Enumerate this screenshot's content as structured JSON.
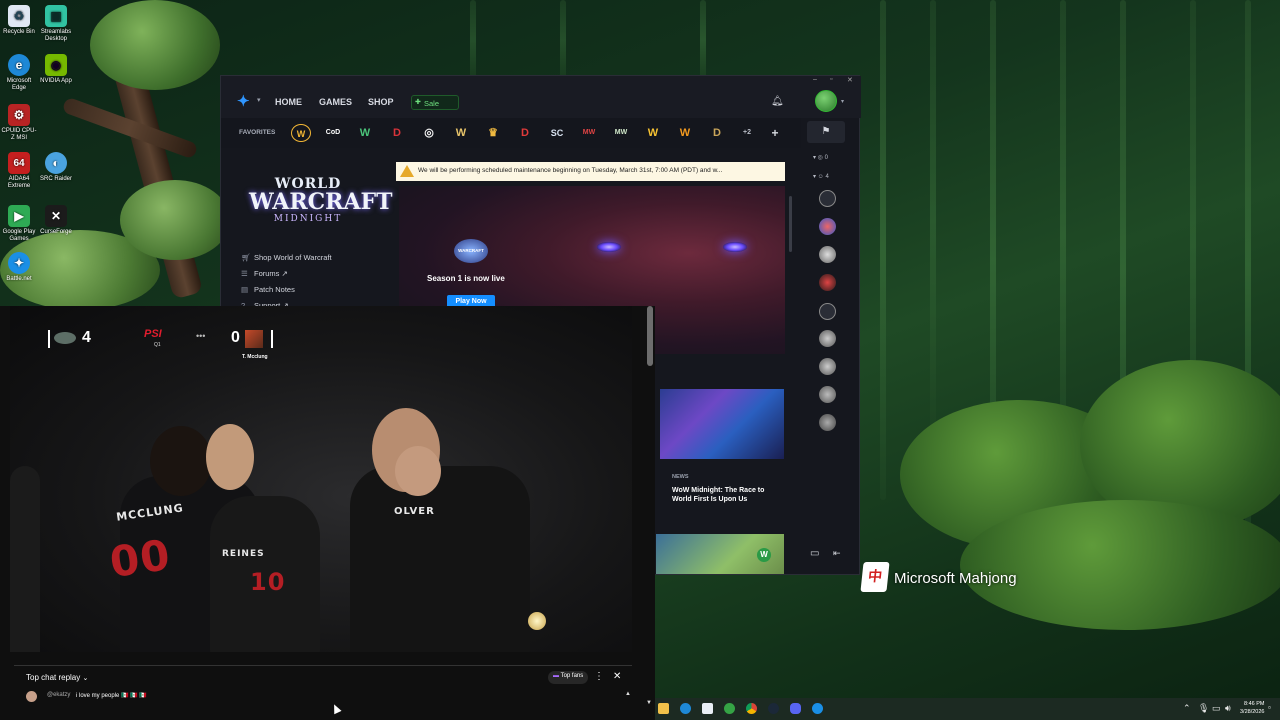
{
  "desktop": {
    "icons": [
      {
        "label": "Recycle Bin",
        "icon": "recycle-bin-icon",
        "color": "#dfe7f3",
        "glyph": "♻"
      },
      {
        "label": "Streamlabs Desktop",
        "icon": "streamlabs-icon",
        "color": "#31c3a2",
        "glyph": "▣"
      },
      {
        "label": "Microsoft Edge",
        "icon": "edge-icon",
        "color": "#1e88d6",
        "glyph": "e"
      },
      {
        "label": "NVIDIA App",
        "icon": "nvidia-icon",
        "color": "#76b900",
        "glyph": "◉"
      },
      {
        "label": "CPUID CPU-Z MSI",
        "icon": "cpuz-icon",
        "color": "#b82424",
        "glyph": "⚙"
      },
      {
        "label": "AIDA64 Extreme",
        "icon": "aida64-icon",
        "color": "#c41f1f",
        "glyph": "64"
      },
      {
        "label": "SRC Raider",
        "icon": "src-raider-icon",
        "color": "#4aa3df",
        "glyph": "◐"
      },
      {
        "label": "Google Play Games",
        "icon": "google-play-games-icon",
        "color": "#2eaa54",
        "glyph": "▶"
      },
      {
        "label": "CurseForge",
        "icon": "curseforge-icon",
        "color": "#1b1b1b",
        "glyph": "✕"
      },
      {
        "label": "Battle.net",
        "icon": "battlenet-icon",
        "color": "#1a8fe6",
        "glyph": "✦"
      }
    ],
    "mahjong_label": "Microsoft Mahjong",
    "mahjong_tile": "中"
  },
  "bnet": {
    "nav": {
      "home": "HOME",
      "games": "GAMES",
      "shop": "SHOP",
      "sale": "Sale"
    },
    "favorites_label": "FAVORITES",
    "favorites": [
      {
        "glyph": "W",
        "color": "#f2b635",
        "icon": "wow-favorite-icon"
      },
      {
        "glyph": "CoD",
        "color": "#ffffff",
        "icon": "call-of-duty-favorite-icon"
      },
      {
        "glyph": "W",
        "color": "#4bc47a",
        "icon": "wow-classic-favorite-icon"
      },
      {
        "glyph": "D",
        "color": "#d8333a",
        "icon": "diablo-favorite-icon"
      },
      {
        "glyph": "◎",
        "color": "#f2f2f2",
        "icon": "overwatch-favorite-icon"
      },
      {
        "glyph": "W",
        "color": "#e8c46a",
        "icon": "warcraft-favorite-icon"
      },
      {
        "glyph": "♛",
        "color": "#f0b940",
        "icon": "hearthstone-favorite-icon"
      },
      {
        "glyph": "D",
        "color": "#e03a3a",
        "icon": "diablo-immortal-favorite-icon"
      },
      {
        "glyph": "SC",
        "color": "#d8e2f0",
        "icon": "starcraft-favorite-icon"
      },
      {
        "glyph": "MW",
        "color": "#e04444",
        "icon": "modern-warfare-favorite-icon"
      },
      {
        "glyph": "MW",
        "color": "#cfe7c8",
        "icon": "warzone-favorite-icon"
      },
      {
        "glyph": "W",
        "color": "#f6c232",
        "icon": "warcraft-rumble-favorite-icon"
      },
      {
        "glyph": "W",
        "color": "#f39a1f",
        "icon": "warcraft-arclight-favorite-icon"
      },
      {
        "glyph": "D",
        "color": "#c9a55a",
        "icon": "diablo-ii-favorite-icon"
      }
    ],
    "more_count": "+2",
    "maintenance": "We will be performing scheduled maintenance beginning on Tuesday, March 31st, 7:00 AM (PDT) and w...",
    "game_logo": {
      "l1": "WORLD",
      "l2": "WARCRAFT",
      "l3": "MIDNIGHT"
    },
    "side_links": [
      "Shop World of Warcraft",
      "Forums ↗",
      "Patch Notes",
      "Support ↗"
    ],
    "hero": {
      "badge": "WARCRAFT",
      "title": "Season 1 is now live",
      "button": "Play Now"
    },
    "news": {
      "tag": "NEWS",
      "title": "WoW Midnight: The Race to World First Is Upon Us"
    },
    "friends": {
      "online_count": "0",
      "group_count": "4"
    }
  },
  "youtube": {
    "score": {
      "left": "4",
      "right": "0",
      "team_right": "PSI",
      "q": "Q1",
      "player_tag": "T. Mcclung"
    },
    "jerseys": [
      "MCCLUNG",
      "00",
      "REINES",
      "10",
      "OLVER"
    ],
    "chat": {
      "replay_label": "Top chat replay",
      "top_fans": "Top fans",
      "user": "@ekatzy",
      "message": "i love my people 🇲🇽 🇲🇽 🇲🇽"
    }
  },
  "taskbar": {
    "time": "8:46 PM",
    "date": "3/28/2026"
  }
}
